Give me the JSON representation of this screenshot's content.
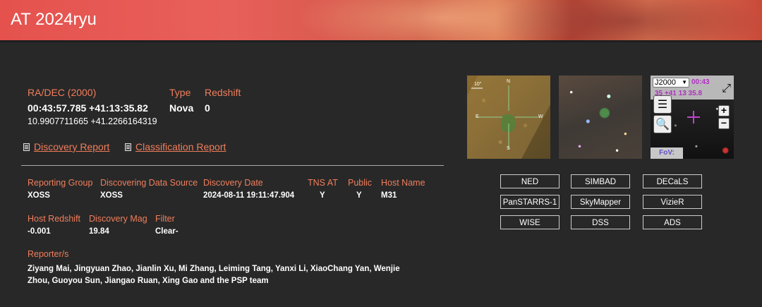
{
  "title": "AT 2024ryu",
  "coords": {
    "radec_label": "RA/DEC (2000)",
    "radec_value": "00:43:57.785 +41:13:35.82",
    "radec_deg": "10.9907711665 +41.2266164319",
    "type_label": "Type",
    "type_value": "Nova",
    "redshift_label": "Redshift",
    "redshift_value": "0"
  },
  "reports": {
    "discovery": "Discovery Report",
    "classification": "Classification Report"
  },
  "fields": {
    "reporting_group_label": "Reporting Group",
    "reporting_group_value": "XOSS",
    "data_source_label": "Discovering Data Source",
    "data_source_value": "XOSS",
    "discovery_date_label": "Discovery Date",
    "discovery_date_value": "2024-08-11 19:11:47.904",
    "tns_at_label": "TNS AT",
    "tns_at_value": "Y",
    "public_label": "Public",
    "public_value": "Y",
    "host_name_label": "Host Name",
    "host_name_value": "M31",
    "host_redshift_label": "Host Redshift",
    "host_redshift_value": "-0.001",
    "discovery_mag_label": "Discovery Mag",
    "discovery_mag_value": "19.84",
    "filter_label": "Filter",
    "filter_value": "Clear-",
    "reporters_label": "Reporter/s",
    "reporters_value": "Ziyang Mai, Jingyuan Zhao, Jianlin Xu, Mi Zhang, Leiming Tang, Yanxi Li, XiaoChang Yan, Wenjie Zhou, Guoyou Sun, Jiangao Ruan, Xing Gao and the PSP team"
  },
  "finder": {
    "scale_label": "10\"",
    "n": "N",
    "s": "S",
    "e": "E",
    "w": "W"
  },
  "aladin": {
    "frame": "J2000",
    "coord_line1": "00:43",
    "coord_line2": "35 +41 13 35.8",
    "fov": "FoV: 4.82'"
  },
  "links": [
    "NED",
    "SIMBAD",
    "DECaLS",
    "PanSTARRS-1",
    "SkyMapper",
    "VizieR",
    "WISE",
    "DSS",
    "ADS"
  ]
}
